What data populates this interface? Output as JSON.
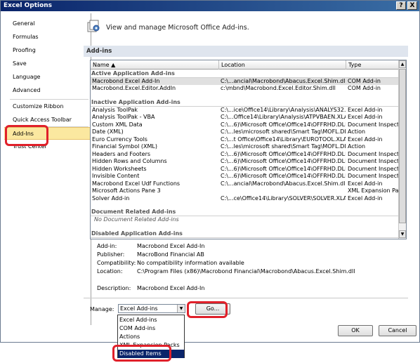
{
  "window": {
    "title": "Excel Options",
    "help_label": "?",
    "close_label": "X"
  },
  "sidebar": {
    "items": [
      {
        "label": "General"
      },
      {
        "label": "Formulas"
      },
      {
        "label": "Proofing"
      },
      {
        "label": "Save"
      },
      {
        "label": "Language"
      },
      {
        "label": "Advanced"
      },
      {
        "label": "Customize Ribbon"
      },
      {
        "label": "Quick Access Toolbar"
      },
      {
        "label": "Add-Ins"
      },
      {
        "label": "Trust Center"
      }
    ]
  },
  "header": {
    "icon": "addins-icon",
    "text": "View and manage Microsoft Office Add-ins."
  },
  "section": {
    "title": "Add-ins"
  },
  "table": {
    "columns": [
      "Name ▲",
      "Location",
      "Type"
    ],
    "groups": [
      {
        "title": "Active Application Add-ins",
        "rows": [
          {
            "name": "Macrobond Excel Add-In",
            "location": "C:\\...ancial\\Macrobond\\Abacus.Excel.Shim.dll",
            "type": "COM Add-in"
          },
          {
            "name": "Macrobond.Excel.Editor.AddIn",
            "location": "c:\\mbnd\\Macrobond.Excel.Editor.Shim.dll",
            "type": "COM Add-in"
          }
        ]
      },
      {
        "title": "Inactive Application Add-ins",
        "rows": [
          {
            "name": "Analysis ToolPak",
            "location": "C:\\...ice\\Office14\\Library\\Analysis\\ANALYS32.XLL",
            "type": "Excel Add-in"
          },
          {
            "name": "Analysis ToolPak - VBA",
            "location": "C:\\...Office14\\Library\\Analysis\\ATPVBAEN.XLAM",
            "type": "Excel Add-in"
          },
          {
            "name": "Custom XML Data",
            "location": "C:\\...6)\\Microsoft Office\\Office14\\OFFRHD.DLL",
            "type": "Document Inspector"
          },
          {
            "name": "Date (XML)",
            "location": "C:\\...les\\microsoft shared\\Smart Tag\\MOFL.DLL",
            "type": "Action"
          },
          {
            "name": "Euro Currency Tools",
            "location": "C:\\...t Office\\Office14\\Library\\EUROTOOL.XLAM",
            "type": "Excel Add-in"
          },
          {
            "name": "Financial Symbol (XML)",
            "location": "C:\\...les\\microsoft shared\\Smart Tag\\MOFL.DLL",
            "type": "Action"
          },
          {
            "name": "Headers and Footers",
            "location": "C:\\...6)\\Microsoft Office\\Office14\\OFFRHD.DLL",
            "type": "Document Inspector"
          },
          {
            "name": "Hidden Rows and Columns",
            "location": "C:\\...6)\\Microsoft Office\\Office14\\OFFRHD.DLL",
            "type": "Document Inspector"
          },
          {
            "name": "Hidden Worksheets",
            "location": "C:\\...6)\\Microsoft Office\\Office14\\OFFRHD.DLL",
            "type": "Document Inspector"
          },
          {
            "name": "Invisible Content",
            "location": "C:\\...6)\\Microsoft Office\\Office14\\OFFRHD.DLL",
            "type": "Document Inspector"
          },
          {
            "name": "Macrobond Excel Udf Functions",
            "location": "C:\\...ancial\\Macrobond\\Abacus.Excel.Shim.dll",
            "type": "Excel Add-in"
          },
          {
            "name": "Microsoft Actions Pane 3",
            "location": "",
            "type": "XML Expansion Pack"
          },
          {
            "name": "Solver Add-in",
            "location": "C:\\...ce\\Office14\\Library\\SOLVER\\SOLVER.XLAM",
            "type": "Excel Add-in"
          }
        ]
      },
      {
        "title": "Document Related Add-ins",
        "empty_text": "No Document Related Add-ins"
      },
      {
        "title": "Disabled Application Add-ins"
      }
    ]
  },
  "details": {
    "addin_label": "Add-in:",
    "addin_value": "Macrobond Excel Add-In",
    "publisher_label": "Publisher:",
    "publisher_value": "MacroBond Financial AB",
    "compat_label": "Compatibility:",
    "compat_value": "No compatibility information available",
    "location_label": "Location:",
    "location_value": "C:\\Program Files (x86)\\Macrobond Financial\\Macrobond\\Abacus.Excel.Shim.dll",
    "description_label": "Description:",
    "description_value": "Macrobond Excel Add-In"
  },
  "manage": {
    "label": "Manage:",
    "selected": "Excel Add-ins",
    "go_label": "Go...",
    "options": [
      "Excel Add-ins",
      "COM Add-ins",
      "Actions",
      "XML Expansion Packs",
      "Disabled Items"
    ],
    "highlighted_option": "Disabled Items"
  },
  "footer": {
    "ok_label": "OK",
    "cancel_label": "Cancel"
  },
  "colors": {
    "highlight_red": "#e0202a",
    "active_sidebar": "#fbe8a0",
    "dropdown_selected": "#0a246a"
  }
}
